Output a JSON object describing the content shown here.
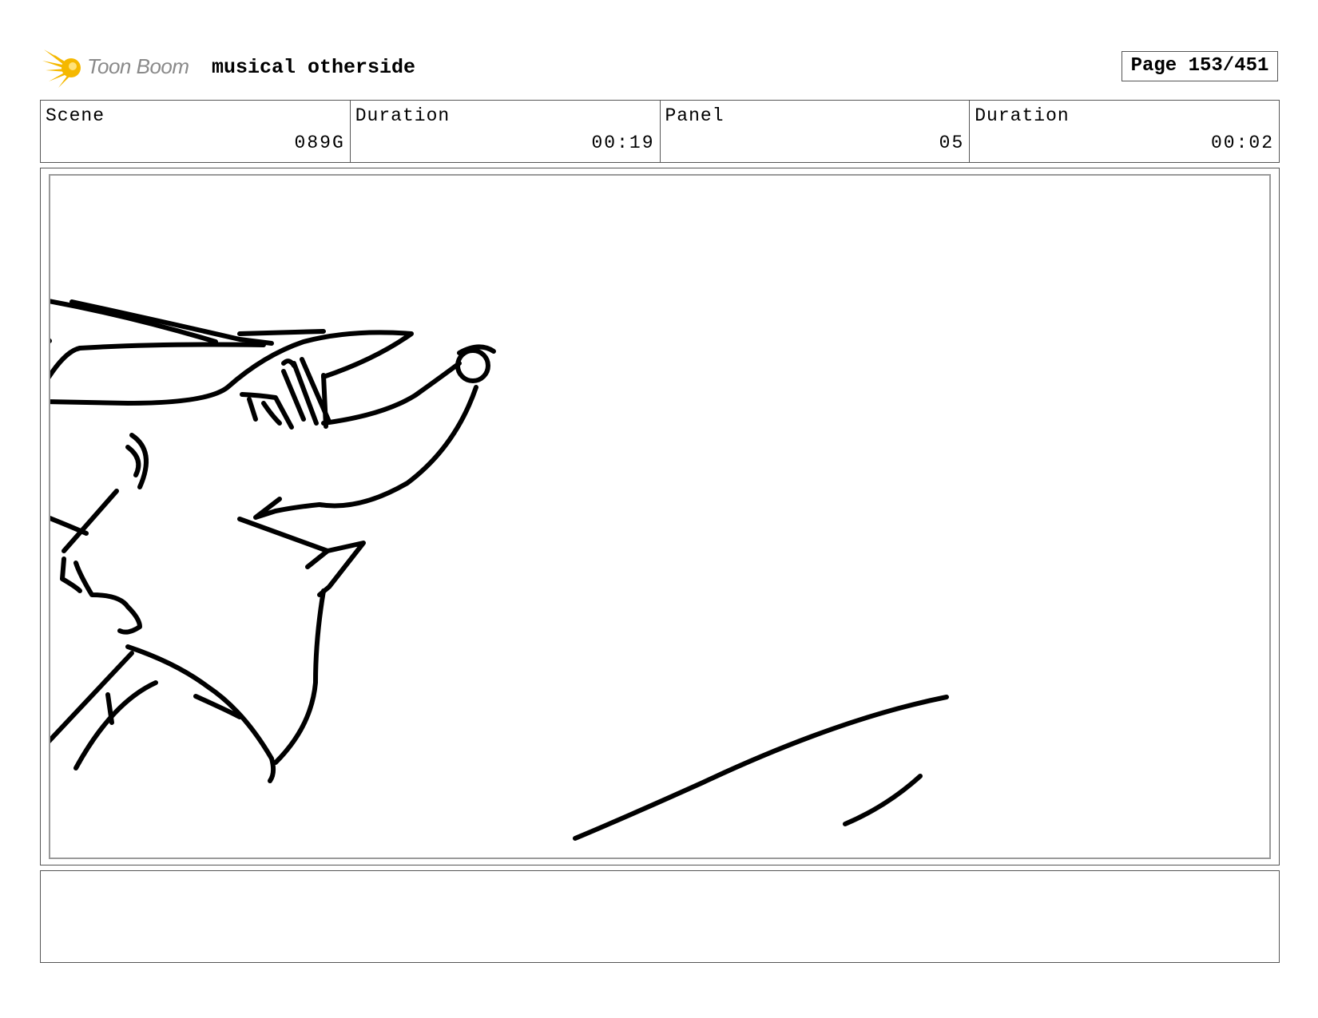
{
  "header": {
    "logo_text": "Toon Boom",
    "project_title": "musical otherside",
    "page_label": "Page 153/451"
  },
  "info": {
    "scene": {
      "label": "Scene",
      "value": "089G"
    },
    "scene_duration": {
      "label": "Duration",
      "value": "00:19"
    },
    "panel": {
      "label": "Panel",
      "value": "05"
    },
    "panel_duration": {
      "label": "Duration",
      "value": "00:02"
    }
  },
  "drawing": {
    "icon": "storyboard-sketch",
    "subject": "character-head-sketch"
  },
  "colors": {
    "logo_star": "#f5b800",
    "logo_text": "#8a8a8a",
    "frame_border": "#9a9a9a",
    "ink": "#000000"
  }
}
